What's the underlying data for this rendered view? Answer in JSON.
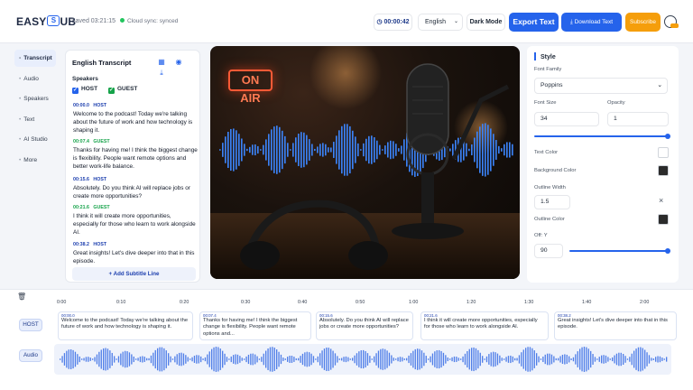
{
  "topbar": {
    "logo_text_1": "EASY",
    "logo_box": "S",
    "logo_text_2": "UB",
    "saved": "Saved 03:21:15",
    "sync": "Cloud sync: synced",
    "timer": "00:00:42",
    "language": "English",
    "dark_mode": "Dark Mode",
    "export": "Export Text",
    "download": "Download Text",
    "subscribe": "Subscribe"
  },
  "nav": [
    "Transcript",
    "Audio",
    "Speakers",
    "Text",
    "AI Studio",
    "More"
  ],
  "transcript": {
    "title": "English Transcript",
    "speakers_label": "Speakers",
    "host": "HOST",
    "guest": "GUEST",
    "add_line": "+ Add Subtitle Line",
    "segments": [
      {
        "time": "00:00.0",
        "speaker": "HOST",
        "text": "Welcome to the podcast! Today we're talking about the future of work and how technology is shaping it."
      },
      {
        "time": "00:07.4",
        "speaker": "GUEST",
        "text": "Thanks for having me! I think the biggest change is flexibility. People want remote options and better work-life balance."
      },
      {
        "time": "00:15.6",
        "speaker": "HOST",
        "text": "Absolutely. Do you think AI will replace jobs or create more opportunities?"
      },
      {
        "time": "00:21.6",
        "speaker": "GUEST",
        "text": "I think it will create more opportunities, especially for those who learn to work alongside AI."
      },
      {
        "time": "00:38.2",
        "speaker": "HOST",
        "text": "Great insights! Let's dive deeper into that in this episode."
      }
    ]
  },
  "video": {
    "sign": "ON AIR"
  },
  "style": {
    "title": "Style",
    "font_family_label": "Font Family",
    "font_family": "Poppins",
    "font_size_label": "Font Size",
    "font_size": "34",
    "opacity_label": "Opacity",
    "opacity": "1",
    "size_slider_fraction": 1.0,
    "text_color_label": "Text Color",
    "text_color": "#ffffff",
    "bg_color_label": "Background Color",
    "bg_color": "#2b2b2b",
    "outline_width_label": "Outline Width",
    "outline_width": "1.5",
    "outline_color_label": "Outline Color",
    "outline_color": "#2b2b2b",
    "offset_label": "Off: Y",
    "offset": "90",
    "offset_slider_fraction": 1.0
  },
  "timeline": {
    "ticks": [
      "0:00",
      "0:10",
      "0:20",
      "0:30",
      "0:40",
      "0:50",
      "1:00",
      "1:20",
      "1:30",
      "1:40",
      "2:00"
    ],
    "host_label": "HOST",
    "audio_label": "Audio",
    "clips": [
      {
        "time": "00:00.0",
        "text": "Welcome to the podcast! Today we're talking about the future of work and how technology is shaping it."
      },
      {
        "time": "00:07.4",
        "text": "Thanks for having me! I think the biggest change is flexibility. People want remote options and..."
      },
      {
        "time": "00:15.6",
        "text": "Absolutely. Do you think AI will replace jobs or create more opportunities?"
      },
      {
        "time": "00:21.6",
        "text": "I think it will create more opportunities, especially for those who learn to work alongside AI."
      },
      {
        "time": "00:38.2",
        "text": "Great insights! Let's dive deeper into that in this episode."
      }
    ]
  },
  "colors": {
    "accent": "#2563eb",
    "host": "#1e40af",
    "guest": "#16a34a",
    "subscribe": "#f59e0b",
    "wave": "#3b82f6"
  }
}
